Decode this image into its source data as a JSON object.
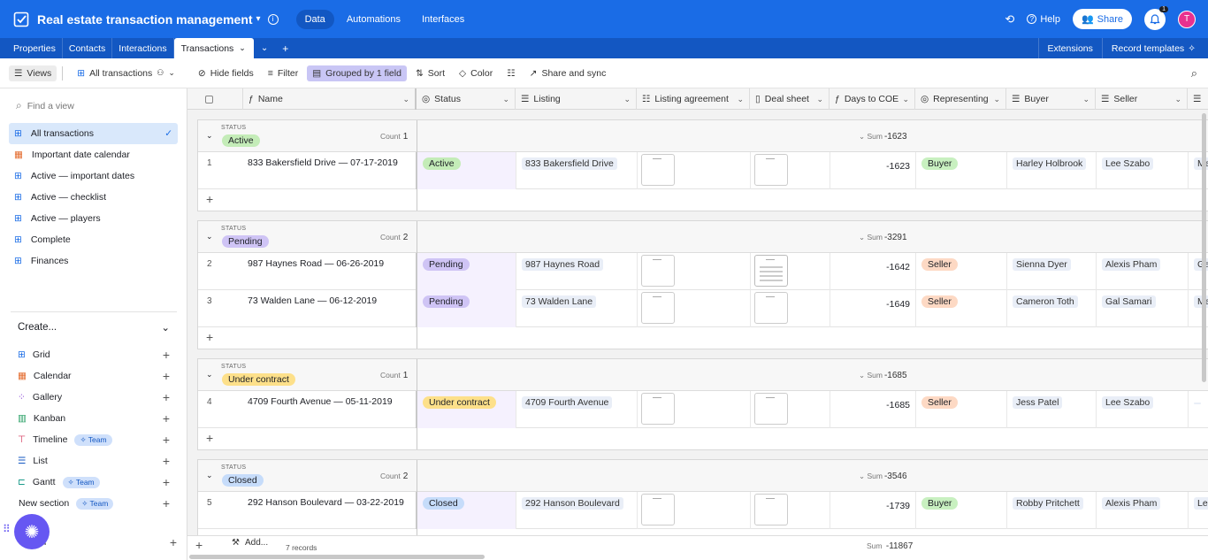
{
  "app": {
    "base_title": "Real estate transaction management",
    "tabs": [
      "Data",
      "Automations",
      "Interfaces"
    ],
    "help": "Help",
    "share": "Share",
    "notifications": "1",
    "avatar_letter": "T"
  },
  "tables": {
    "items": [
      "Properties",
      "Contacts",
      "Interactions",
      "Transactions"
    ],
    "right": [
      "Extensions",
      "Record templates"
    ]
  },
  "viewbar": {
    "views": "Views",
    "current_view": "All transactions",
    "hide_fields": "Hide fields",
    "filter": "Filter",
    "grouped": "Grouped by 1 field",
    "sort": "Sort",
    "color": "Color",
    "share_sync": "Share and sync"
  },
  "sidebar": {
    "find_placeholder": "Find a view",
    "views": [
      "All transactions",
      "Important date calendar",
      "Active — important dates",
      "Active — checklist",
      "Active — players",
      "Complete",
      "Finances"
    ],
    "create_label": "Create...",
    "create_items": [
      "Grid",
      "Calendar",
      "Gallery",
      "Kanban",
      "Timeline",
      "List",
      "Gantt",
      "New section"
    ],
    "team_badge": "Team",
    "form_label": "rm"
  },
  "columns": [
    "Name",
    "Status",
    "Listing",
    "Listing agreement",
    "Deal sheet",
    "Days to COE",
    "Representing",
    "Buyer",
    "Seller"
  ],
  "group_labels": {
    "status": "STATUS",
    "count": "Count",
    "sum": "Sum"
  },
  "groups": [
    {
      "status": "Active",
      "color": "#c4ecb8",
      "count": "1",
      "sum": "-1623",
      "rows": [
        {
          "n": "1",
          "name": "833 Bakersfield Drive — 07-17-2019",
          "listing": "833 Bakersfield Drive",
          "doc": false,
          "days": "-1623",
          "rep": "Buyer",
          "buyer": "Harley Holbrook",
          "seller": "Lee Szabo",
          "extra": "Mac"
        }
      ]
    },
    {
      "status": "Pending",
      "color": "#cfc4f5",
      "count": "2",
      "sum": "-3291",
      "rows": [
        {
          "n": "2",
          "name": "987 Haynes Road — 06-26-2019",
          "listing": "987 Haynes Road",
          "doc": true,
          "days": "-1642",
          "rep": "Seller",
          "buyer": "Sienna Dyer",
          "seller": "Alexis Pham",
          "extra": "Gal"
        },
        {
          "n": "3",
          "name": "73 Walden Lane — 06-12-2019",
          "listing": "73 Walden Lane",
          "doc": false,
          "days": "-1649",
          "rep": "Seller",
          "buyer": "Cameron Toth",
          "seller": "Gal Samari",
          "extra": "Mac"
        }
      ]
    },
    {
      "status": "Under contract",
      "color": "#fde08a",
      "count": "1",
      "sum": "-1685",
      "rows": [
        {
          "n": "4",
          "name": "4709 Fourth Avenue — 05-11-2019",
          "listing": "4709 Fourth Avenue",
          "doc": false,
          "days": "-1685",
          "rep": "Seller",
          "buyer": "Jess Patel",
          "seller": "Lee Szabo",
          "extra": ""
        }
      ]
    },
    {
      "status": "Closed",
      "color": "#c6dcfa",
      "count": "2",
      "sum": "-3546",
      "rows": [
        {
          "n": "5",
          "name": "292 Hanson Boulevard — 03-22-2019",
          "listing": "292 Hanson Boulevard",
          "doc": false,
          "days": "-1739",
          "rep": "Buyer",
          "buyer": "Robby Pritchett",
          "seller": "Alexis Pham",
          "extra": "Lee"
        }
      ]
    }
  ],
  "rep_colors": {
    "Buyer": "#c8f0c0",
    "Seller": "#fdd9c4"
  },
  "footer": {
    "add": "Add...",
    "records": "7 records",
    "sum_label": "Sum",
    "sum": "-11867"
  }
}
